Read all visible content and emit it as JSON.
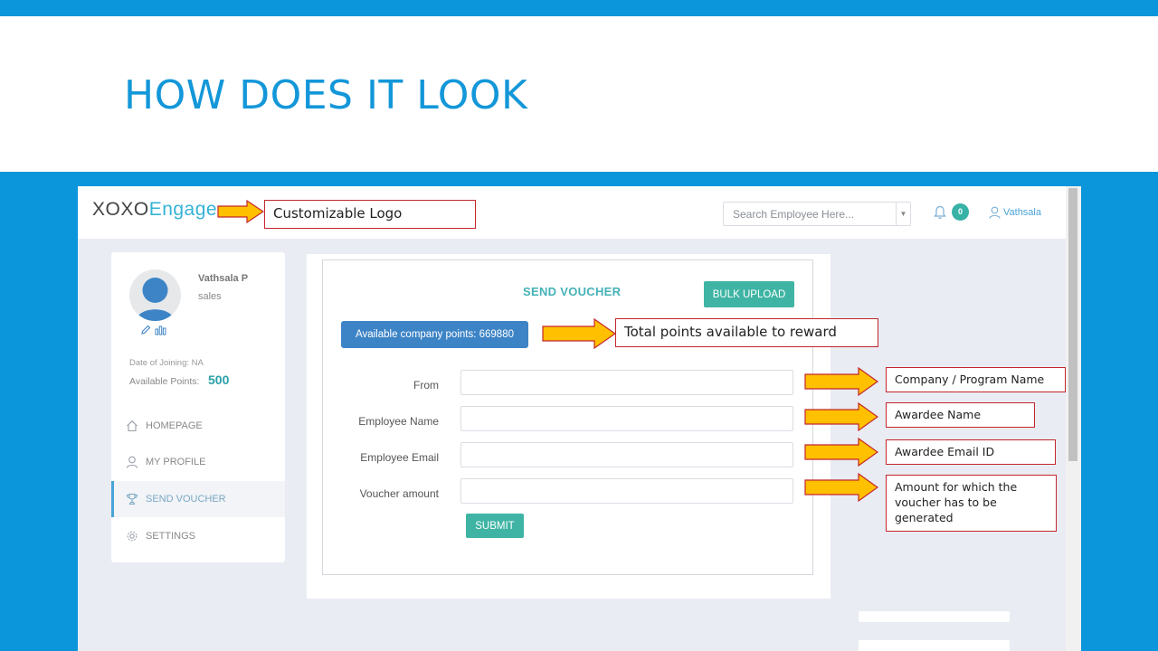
{
  "slide": {
    "title": "HOW DOES IT LOOK"
  },
  "app": {
    "logo": {
      "part1": "XOXO",
      "part2": "Engage"
    },
    "search": {
      "placeholder": "Search Employee Here..."
    },
    "notifications": {
      "count": "0"
    },
    "user": {
      "name": "Vathsala"
    }
  },
  "profile": {
    "name": "Vathsala P",
    "department": "sales",
    "date_of_joining": "Date of Joining: NA",
    "available_points_label": "Available Points:",
    "available_points_value": "500"
  },
  "nav": {
    "items": [
      {
        "label": "HOMEPAGE",
        "icon": "home-icon",
        "active": false
      },
      {
        "label": "MY PROFILE",
        "icon": "user-icon",
        "active": false
      },
      {
        "label": "SEND VOUCHER",
        "icon": "trophy-icon",
        "active": true
      },
      {
        "label": "SETTINGS",
        "icon": "gear-icon",
        "active": false
      }
    ]
  },
  "form": {
    "title": "SEND VOUCHER",
    "bulk_upload_label": "BULK UPLOAD",
    "company_points_label": "Available company points: 669880",
    "fields": [
      {
        "label": "From",
        "value": ""
      },
      {
        "label": "Employee Name",
        "value": ""
      },
      {
        "label": "Employee Email",
        "value": ""
      },
      {
        "label": "Voucher amount",
        "value": ""
      }
    ],
    "submit_label": "SUBMIT"
  },
  "callouts": {
    "logo": "Customizable Logo",
    "points": "Total points available to reward",
    "from": "Company / Program Name",
    "name": "Awardee Name",
    "email": "Awardee Email ID",
    "amount": "Amount for which the voucher has to be generated"
  },
  "colors": {
    "slide_blue": "#0b96db",
    "title_blue": "#1397d9",
    "teal": "#3fb4a4",
    "button_blue": "#3d84c6",
    "arrow_fill": "#ffc000",
    "arrow_stroke": "#c3262c"
  }
}
